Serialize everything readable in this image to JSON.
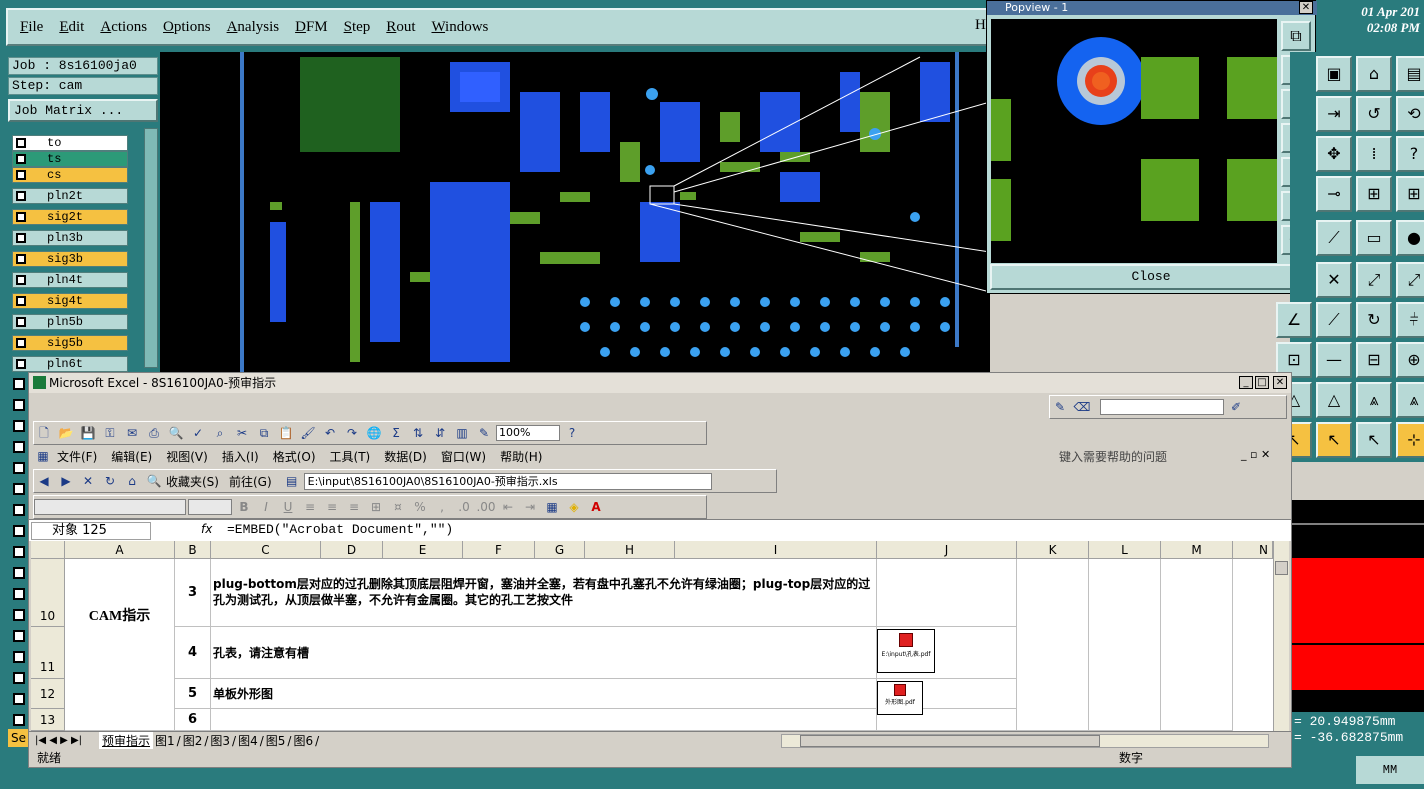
{
  "cam": {
    "menu": [
      "File",
      "Edit",
      "Actions",
      "Options",
      "Analysis",
      "DFM",
      "Step",
      "Rout",
      "Windows"
    ],
    "menu_cut": "H",
    "clock_date": "01 Apr 201",
    "clock_time": "02:08 PM",
    "job": "Job : 8s16100ja0",
    "step": "Step: cam",
    "job_matrix": "Job Matrix ...",
    "layers": [
      "to",
      "ts",
      "cs",
      "pln2t",
      "sig2t",
      "pln3b",
      "sig3b",
      "pln4t",
      "sig4t",
      "pln5b",
      "sig5b",
      "pln6t"
    ],
    "coord_x": "= 20.949875mm",
    "coord_y": "= -36.682875mm",
    "units": "MM",
    "bottom_text": "Se"
  },
  "popview": {
    "title": "Popview - 1",
    "close": "Close"
  },
  "excel": {
    "title": "Microsoft Excel - 8S16100JA0-预审指示",
    "zoom": "100%",
    "menu": [
      "文件(F)",
      "编辑(E)",
      "视图(V)",
      "插入(I)",
      "格式(O)",
      "工具(T)",
      "数据(D)",
      "窗口(W)",
      "帮助(H)"
    ],
    "help_placeholder": "键入需要帮助的问题",
    "web_favorites": "收藏夹(S)",
    "web_goto": "前往(G)",
    "path": "E:\\input\\8S16100JA0\\8S16100JA0-预审指示.xls",
    "name_box": "对象 125",
    "fx": "fx",
    "formula": "=EMBED(\"Acrobat Document\",\"\")",
    "columns": [
      "A",
      "B",
      "C",
      "D",
      "E",
      "F",
      "G",
      "H",
      "I",
      "J",
      "K",
      "L",
      "M",
      "N"
    ],
    "rows": [
      "10",
      "11",
      "12",
      "13"
    ],
    "a_label": "CAM指示",
    "items": [
      {
        "no": "3",
        "text": "plug-bottom层对应的过孔删除其顶底层阻焊开窗，塞油并全塞，若有盘中孔塞孔不允许有绿油圈；plug-top层对应的过孔为测试孔，从顶层做半塞，不允许有金属圈。其它的孔工艺按文件"
      },
      {
        "no": "4",
        "text": "孔表，请注意有槽"
      },
      {
        "no": "5",
        "text": "单板外形图"
      },
      {
        "no": "6",
        "text": ""
      }
    ],
    "embed1": "E:\\input\\孔表.pdf",
    "embed2": "外形图.pdf",
    "sheets": [
      "预审指示",
      "图1",
      "图2",
      "图3",
      "图4",
      "图5",
      "图6"
    ],
    "status_ready": "就绪",
    "status_num": "数字"
  }
}
